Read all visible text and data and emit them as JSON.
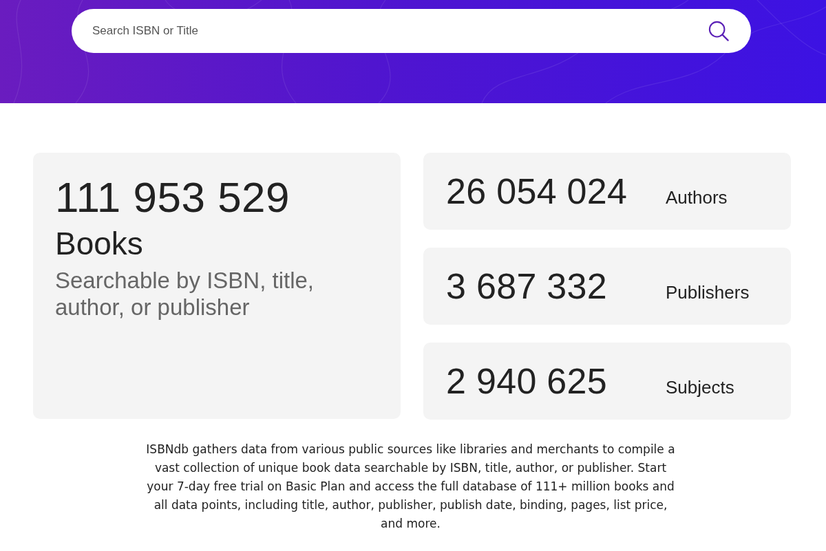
{
  "search": {
    "placeholder": "Search ISBN or Title"
  },
  "featured_stat": {
    "value": "111 953 529",
    "label": "Books",
    "description": "Searchable by ISBN, title, author, or publisher"
  },
  "stats": [
    {
      "value": "26 054 024",
      "label": "Authors"
    },
    {
      "value": "3 687 332",
      "label": "Publishers"
    },
    {
      "value": "2 940 625",
      "label": "Subjects"
    }
  ],
  "description": "ISBNdb gathers data from various public sources like libraries and merchants to compile a vast collection of unique book data searchable by ISBN, title, author, or publisher. Start your 7-day free trial on Basic Plan and access the full database of 111+ million books and all data points, including title, author, publisher, publish date, binding, pages, list price, and more."
}
